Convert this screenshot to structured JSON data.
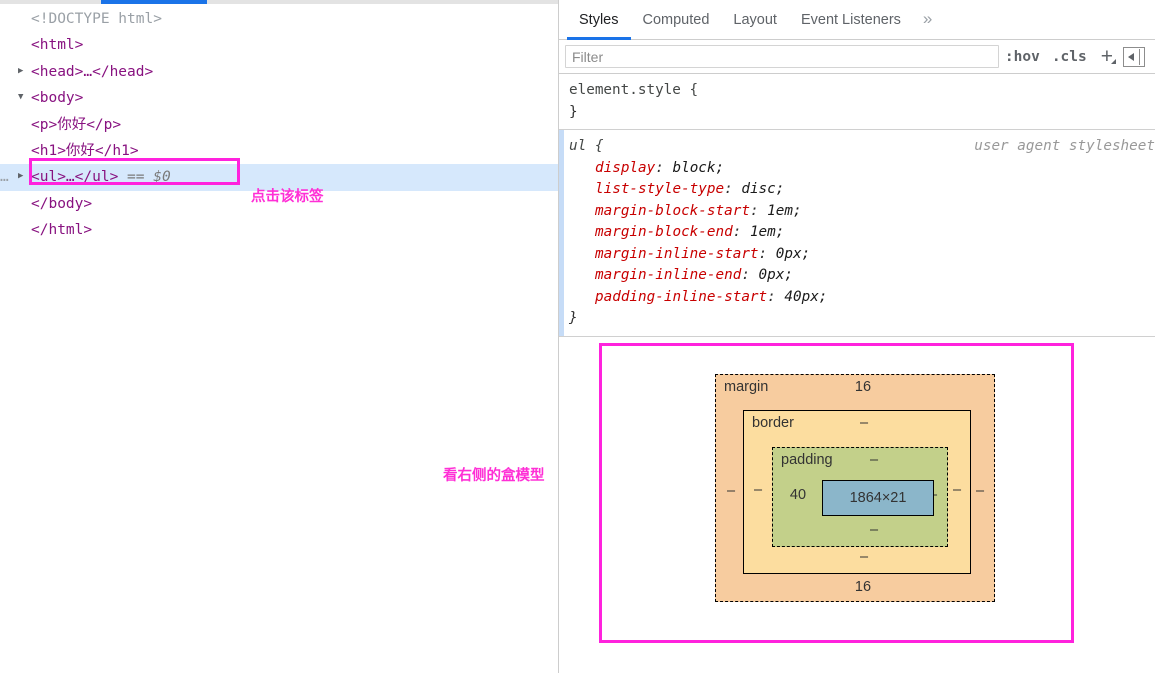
{
  "dom_panel": {
    "rows": [
      {
        "indent": 0,
        "triangle": "none",
        "text": "<!DOCTYPE html>",
        "kind": "doctype",
        "selected": false
      },
      {
        "indent": 0,
        "triangle": "none",
        "text": "<html>",
        "kind": "tag",
        "selected": false
      },
      {
        "indent": 0,
        "triangle": "collapsed",
        "text": "<head>…</head>",
        "kind": "tag",
        "selected": false
      },
      {
        "indent": 0,
        "triangle": "expanded",
        "text": "<body>",
        "kind": "tag",
        "selected": false
      },
      {
        "indent": 1,
        "triangle": "none",
        "text": "<p>你好</p>",
        "kind": "tag",
        "selected": false
      },
      {
        "indent": 1,
        "triangle": "none",
        "text": "<h1>你好</h1>",
        "kind": "tag",
        "selected": false
      },
      {
        "indent": 1,
        "triangle": "collapsed",
        "text": "<ul>…</ul>",
        "kind": "tag",
        "selected": true,
        "suffix": "== $0",
        "gutter": "…"
      },
      {
        "indent": 1,
        "triangle": "none",
        "text": "</body>",
        "kind": "tag",
        "selected": false
      },
      {
        "indent": 0,
        "triangle": "none",
        "text": "</html>",
        "kind": "tag",
        "selected": false
      }
    ]
  },
  "annotations": {
    "click_tag": "点击该标签",
    "see_box_model": "看右侧的盒模型",
    "color": "#ff2fd6",
    "highlight_color": "#ff22dd"
  },
  "styles_panel": {
    "tabs": [
      {
        "label": "Styles",
        "active": true
      },
      {
        "label": "Computed",
        "active": false
      },
      {
        "label": "Layout",
        "active": false
      },
      {
        "label": "Event Listeners",
        "active": false
      }
    ],
    "more_tabs_icon": "»",
    "filter": {
      "value": "",
      "placeholder": "Filter"
    },
    "toolbar": {
      "hov_label": ":hov",
      "cls_label": ".cls",
      "new_rule_label": "+",
      "sidebar_toggle_label": ""
    },
    "rules": [
      {
        "selector": "element.style {",
        "close": "}",
        "origin": "",
        "user_agent": false,
        "marker": false,
        "declarations": []
      },
      {
        "selector": "ul {",
        "close": "}",
        "origin": "user agent stylesheet",
        "user_agent": true,
        "marker": true,
        "declarations": [
          {
            "prop": "display",
            "value": "block;"
          },
          {
            "prop": "list-style-type",
            "value": "disc;"
          },
          {
            "prop": "margin-block-start",
            "value": "1em;"
          },
          {
            "prop": "margin-block-end",
            "value": "1em;"
          },
          {
            "prop": "margin-inline-start",
            "value": "0px;"
          },
          {
            "prop": "margin-inline-end",
            "value": "0px;"
          },
          {
            "prop": "padding-inline-start",
            "value": "40px;"
          }
        ]
      }
    ]
  },
  "box_model": {
    "margin": {
      "label": "margin",
      "top": "16",
      "right": "–",
      "bottom": "16",
      "left": "–",
      "color": "#f7cc9f"
    },
    "border": {
      "label": "border",
      "top": "–",
      "right": "–",
      "bottom": "–",
      "left": "–",
      "color": "#fcdd9f"
    },
    "padding": {
      "label": "padding",
      "top": "–",
      "right": "–",
      "bottom": "–",
      "left": "40",
      "color": "#c3d08a"
    },
    "content": {
      "dimensions": "1864×21",
      "color": "#8bb6ca"
    }
  }
}
